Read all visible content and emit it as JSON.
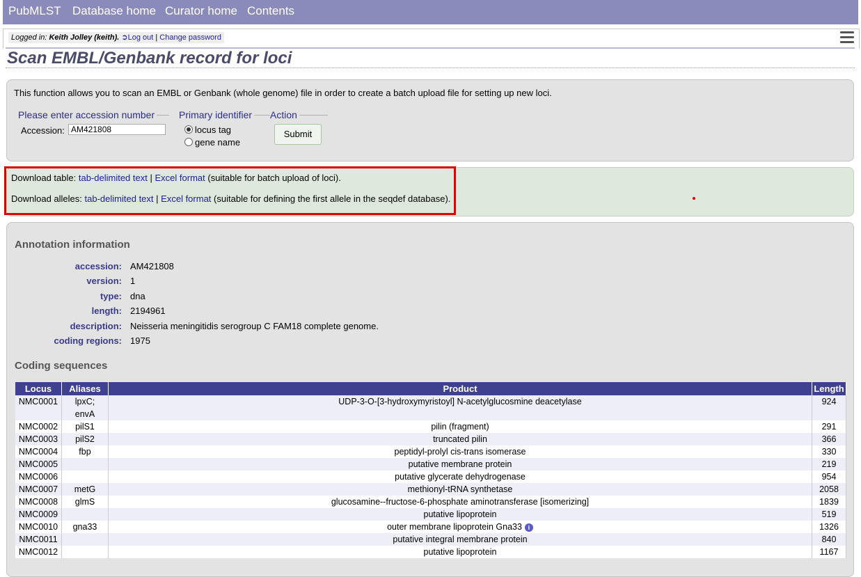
{
  "nav": {
    "items": [
      "PubMLST",
      "Database home",
      "Curator home",
      "Contents"
    ]
  },
  "login": {
    "prefix": "Logged in:",
    "user": "Keith Jolley (keith).",
    "logout": "Log out",
    "separator": "|",
    "change_password": "Change password"
  },
  "page_title": "Scan EMBL/Genbank record for loci",
  "intro": {
    "text": "This function allows you to scan an EMBL or Genbank (whole genome) file in order to create a batch upload file for setting up new loci.",
    "legend_accession": "Please enter accession number",
    "accession_label": "Accession:",
    "accession_value": "AM421808",
    "legend_primary": "Primary identifier",
    "radio_locus_tag": "locus tag",
    "radio_gene_name": "gene name",
    "legend_action": "Action",
    "submit_label": "Submit"
  },
  "download": {
    "table_prefix": "Download table:",
    "table_tab": "tab-delimited text",
    "sep": "|",
    "table_excel": "Excel format",
    "table_suffix": "(suitable for batch upload of loci).",
    "alleles_prefix": "Download alleles:",
    "alleles_tab": "tab-delimited text",
    "alleles_excel": "Excel format",
    "alleles_suffix": "(suitable for defining the first allele in the seqdef database)."
  },
  "annotation": {
    "heading": "Annotation information",
    "fields": [
      {
        "key": "accession:",
        "value": "AM421808"
      },
      {
        "key": "version:",
        "value": "1"
      },
      {
        "key": "type:",
        "value": "dna"
      },
      {
        "key": "length:",
        "value": "2194961"
      },
      {
        "key": "description:",
        "value": "Neisseria meningitidis serogroup C FAM18 complete genome."
      },
      {
        "key": "coding regions:",
        "value": "1975"
      }
    ]
  },
  "coding": {
    "heading": "Coding sequences",
    "columns": [
      "Locus",
      "Aliases",
      "Product",
      "Length"
    ],
    "rows": [
      {
        "locus": "NMC0001",
        "aliases": "lpxC;",
        "aliases2": "envA",
        "product": "UDP-3-O-[3-hydroxymyristoyl] N-acetylglucosmine deacetylase",
        "length": "924"
      },
      {
        "locus": "NMC0002",
        "aliases": "pilS1",
        "product": "pilin (fragment)",
        "length": "291"
      },
      {
        "locus": "NMC0003",
        "aliases": "pilS2",
        "product": "truncated pilin",
        "length": "366"
      },
      {
        "locus": "NMC0004",
        "aliases": "fbp",
        "product": "peptidyl-prolyl cis-trans isomerase",
        "length": "330"
      },
      {
        "locus": "NMC0005",
        "aliases": "",
        "product": "putative membrane protein",
        "length": "219"
      },
      {
        "locus": "NMC0006",
        "aliases": "",
        "product": "putative glycerate dehydrogenase",
        "length": "954"
      },
      {
        "locus": "NMC0007",
        "aliases": "metG",
        "product": "methionyl-tRNA synthetase",
        "length": "2058"
      },
      {
        "locus": "NMC0008",
        "aliases": "glmS",
        "product": "glucosamine--fructose-6-phosphate aminotransferase [isomerizing]",
        "length": "1839"
      },
      {
        "locus": "NMC0009",
        "aliases": "",
        "product": "putative lipoprotein",
        "length": "519"
      },
      {
        "locus": "NMC0010",
        "aliases": "gna33",
        "product": "outer membrane lipoprotein Gna33",
        "length": "1326"
      },
      {
        "locus": "NMC0011",
        "aliases": "",
        "product": "putative integral membrane protein",
        "length": "840"
      },
      {
        "locus": "NMC0012",
        "aliases": "",
        "product": "putative lipoprotein",
        "length": "1167"
      }
    ]
  },
  "colors": {
    "nav_bg": "#8b8bbb",
    "table_header_bg": "#404090",
    "link": "#1a1aa6",
    "highlight": "#e00000"
  }
}
